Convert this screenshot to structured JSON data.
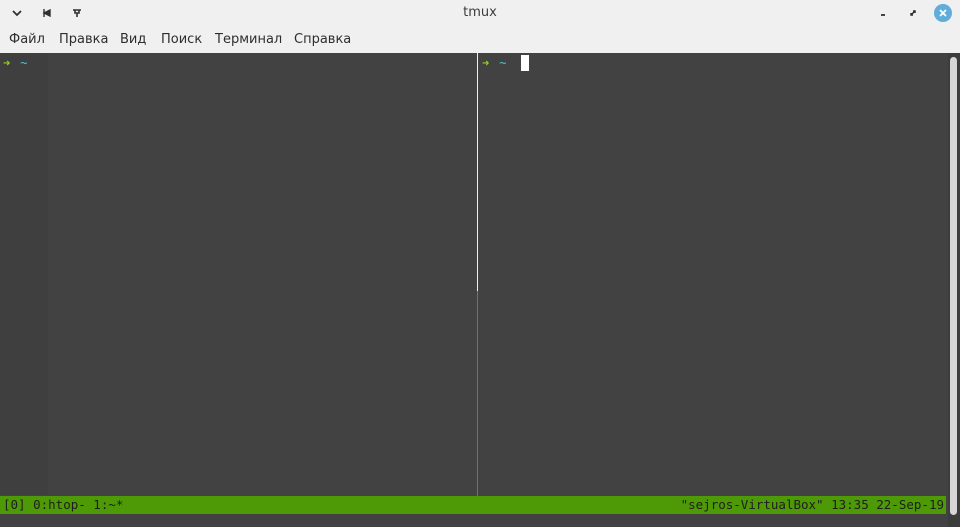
{
  "window": {
    "title": "tmux",
    "left_icons": [
      "chevron-down-icon",
      "pin-icon",
      "push-pin-icon"
    ],
    "right_icons": [
      "minimize-icon",
      "restore-icon",
      "close-icon"
    ]
  },
  "menu": {
    "items": [
      "Файл",
      "Правка",
      "Вид",
      "Поиск",
      "Терминал",
      "Справка"
    ]
  },
  "terminal": {
    "left_pane": {
      "prompt_arrow": "➜",
      "prompt_dir": "~"
    },
    "right_pane": {
      "prompt_arrow": "➜",
      "prompt_dir": "~"
    },
    "status": {
      "left": "[0] 0:htop- 1:~*",
      "right": "\"sejros-VirtualBox\" 13:35 22-Sep-19"
    }
  },
  "colors": {
    "status_bar": "#4e9a06",
    "prompt_arrow": "#8fd21f",
    "prompt_dir": "#4cc4d6",
    "close_button": "#5eaddb"
  }
}
